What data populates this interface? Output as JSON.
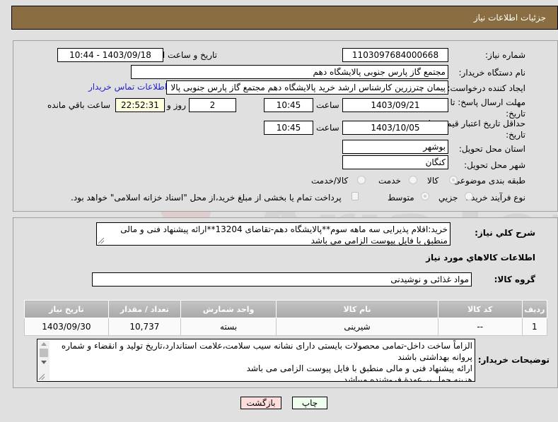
{
  "header": {
    "title": "جزئیات اطلاعات نیاز"
  },
  "fields": {
    "need_number": {
      "label": "شماره نیاز:",
      "value": "1103097684000668"
    },
    "announce_datetime": {
      "label": "تاریخ و ساعت اعلان عمومی:",
      "value": "1403/09/18 - 10:44"
    },
    "buyer_org": {
      "label": "نام دستگاه خریدار:",
      "value": "مجتمع گاز پارس جنوبی  پالایشگاه دهم"
    },
    "requester": {
      "label": "ایجاد کننده درخواست:",
      "value": "پیمان چترزرین کارشناس ارشد خرید پالایشگاه دهم مجتمع گاز پارس جنوبی  پالا",
      "contact_link": "اطلاعات تماس خریدار"
    },
    "reply_deadline": {
      "label_line1": "مهلت ارسال پاسخ: تا",
      "label_line2": "تاریخ:",
      "date": "1403/09/21",
      "time_label": "ساعت",
      "time": "10:45",
      "days": "2",
      "days_label": "روز و",
      "remaining": "22:52:31",
      "remaining_label": "ساعت باقي مانده"
    },
    "price_validity": {
      "label_line1": "حداقل تاریخ اعتبار قیمت: تا",
      "label_line2": "تاریخ:",
      "date": "1403/10/05",
      "time_label": "ساعت",
      "time": "10:45"
    },
    "province": {
      "label": "استان محل تحویل:",
      "value": "بوشهر"
    },
    "city": {
      "label": "شهر محل تحویل:",
      "value": "کنگان"
    },
    "category": {
      "label": "طبقه بندی موضوعی:",
      "options": [
        "کالا",
        "خدمت",
        "کالا/خدمت"
      ],
      "selected": "کالا"
    },
    "process_type": {
      "label": "نوع فرآیند خرید :",
      "options": [
        "جزیي",
        "متوسط"
      ],
      "selected": "متوسط",
      "treasury_note": "پرداخت تمام یا بخشی از مبلغ خرید،از محل \"اسناد خزانه اسلامی\" خواهد بود."
    }
  },
  "description": {
    "label": "شرح کلي نیاز:",
    "text": "خرید:اقلام پذیرایی سه ماهه سوم**پالایشگاه دهم-تقاضای 13204**ارائه پیشنهاد فنی و مالی منطبق با فایل پیوست الزامی می باشد"
  },
  "goods_section": {
    "title": "اطلاعات کالاهاي مورد نیاز",
    "group_label": "گروه کالا:",
    "group_value": "مواد غذائی و نوشیدنی",
    "columns": [
      "ردیف",
      "کد کالا",
      "نام کالا",
      "واحد شمارش",
      "تعداد / مقدار",
      "تاریخ نیاز"
    ],
    "rows": [
      {
        "row": "1",
        "code": "--",
        "name": "شیرینی",
        "unit": "بسته",
        "qty": "10,737",
        "date": "1403/09/30"
      }
    ]
  },
  "buyer_notes": {
    "label": "توضیحات خریدار:",
    "lines": [
      "الزاماً ساخت داخل-تمامی محصولات بایستی دارای نشانه سیب سلامت،علامت استاندارد،تاریخ تولید و انقضاء و شماره پروانه بهداشتی باشند",
      " ارائه پیشنهاد فنی و مالی منطبق با فایل پیوست الزامی می باشد",
      "هزینه حمل بر عهدة فروشنده میباشد."
    ]
  },
  "buttons": {
    "print": "چاپ",
    "back": "بازگشت"
  },
  "colors": {
    "header_bg": "#8b6d42",
    "link": "#2222cc",
    "print_bg": "#eeffee",
    "back_bg": "#ffdddd",
    "remaining_bg": "#ffffe0"
  }
}
